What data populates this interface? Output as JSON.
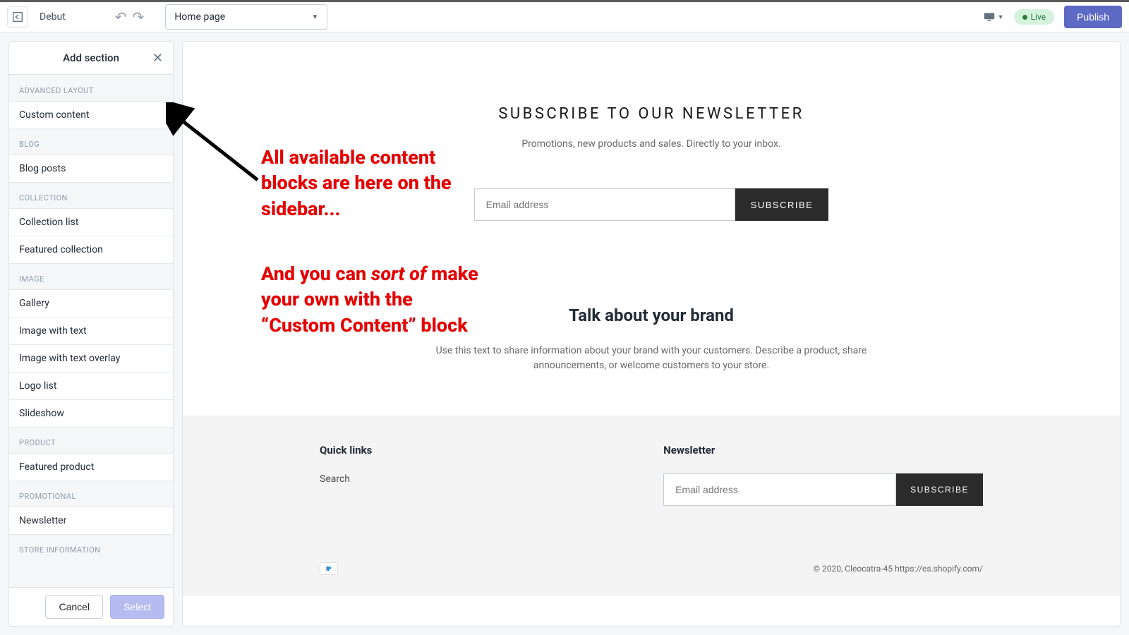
{
  "topbar": {
    "theme_name": "Debut",
    "page_select": "Home page",
    "live_label": "Live",
    "publish_label": "Publish"
  },
  "sidebar": {
    "title": "Add section",
    "groups": [
      {
        "label": "ADVANCED LAYOUT",
        "items": [
          "Custom content"
        ]
      },
      {
        "label": "BLOG",
        "items": [
          "Blog posts"
        ]
      },
      {
        "label": "COLLECTION",
        "items": [
          "Collection list",
          "Featured collection"
        ]
      },
      {
        "label": "IMAGE",
        "items": [
          "Gallery",
          "Image with text",
          "Image with text overlay",
          "Logo list",
          "Slideshow"
        ]
      },
      {
        "label": "PRODUCT",
        "items": [
          "Featured product"
        ]
      },
      {
        "label": "PROMOTIONAL",
        "items": [
          "Newsletter"
        ]
      },
      {
        "label": "STORE INFORMATION",
        "items": []
      }
    ],
    "cancel_label": "Cancel",
    "select_label": "Select"
  },
  "preview": {
    "newsletter": {
      "heading": "SUBSCRIBE TO OUR NEWSLETTER",
      "sub": "Promotions, new products and sales. Directly to your inbox.",
      "placeholder": "Email address",
      "button": "SUBSCRIBE"
    },
    "brand": {
      "heading": "Talk about your brand",
      "text": "Use this text to share information about your brand with your customers. Describe a product, share announcements, or welcome customers to your store."
    },
    "footer": {
      "quicklinks_heading": "Quick links",
      "quicklinks_item": "Search",
      "newsletter_heading": "Newsletter",
      "newsletter_placeholder": "Email address",
      "newsletter_button": "SUBSCRIBE",
      "copyright": "© 2020, Cleocatra-45 https://es.shopify.com/"
    }
  },
  "annotations": {
    "a1": "All available content blocks are here on the sidebar...",
    "a2_pre": "And you can ",
    "a2_em": "sort of",
    "a2_post": " make your own with the “Custom Content” block"
  }
}
